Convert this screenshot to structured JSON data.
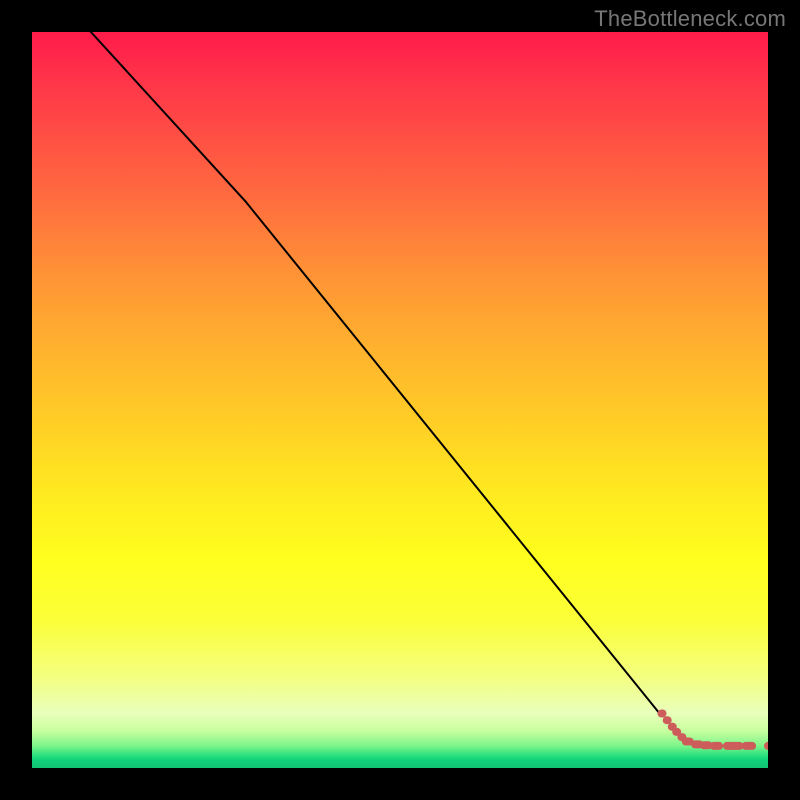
{
  "watermark": "TheBottleneck.com",
  "chart_data": {
    "type": "line",
    "title": "",
    "xlabel": "",
    "ylabel": "",
    "xlim": [
      0,
      100
    ],
    "ylim": [
      0,
      100
    ],
    "grid": false,
    "line": {
      "x": [
        8,
        29,
        86,
        89,
        100
      ],
      "y": [
        100,
        77,
        6.5,
        3.2,
        3.0
      ]
    },
    "dotted_segment": {
      "start_x": 85.5,
      "end_x": 100,
      "points": [
        {
          "x": 85.6,
          "y": 7.4
        },
        {
          "x": 86.3,
          "y": 6.5
        },
        {
          "x": 87.0,
          "y": 5.6
        },
        {
          "x": 87.6,
          "y": 4.9
        },
        {
          "x": 88.3,
          "y": 4.2
        },
        {
          "x": 89.1,
          "y": 3.6
        },
        {
          "x": 90.4,
          "y": 3.2
        },
        {
          "x": 91.6,
          "y": 3.1
        },
        {
          "x": 93.0,
          "y": 3.0
        },
        {
          "x": 94.8,
          "y": 3.0
        },
        {
          "x": 95.7,
          "y": 3.0
        },
        {
          "x": 97.4,
          "y": 3.0
        },
        {
          "x": 100.0,
          "y": 3.0
        }
      ]
    },
    "colors": {
      "line": "#000000",
      "dots": "#cd5d5a"
    }
  }
}
